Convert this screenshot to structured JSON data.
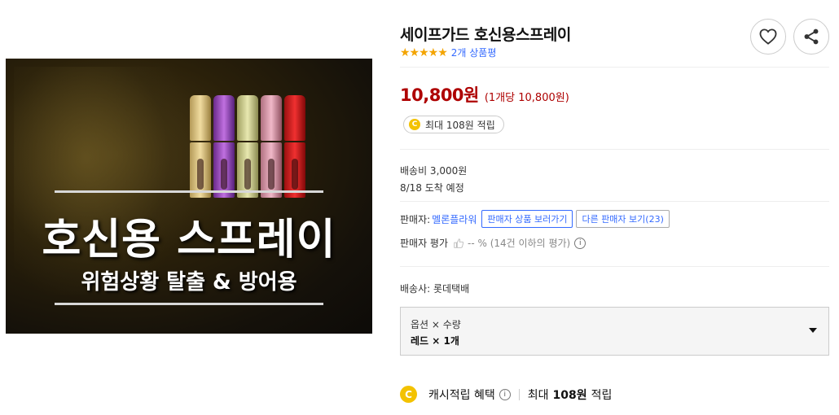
{
  "product": {
    "title": "세이프가드 호신용스프레이",
    "stars": "★★★★★",
    "review_count": "2개 상품평",
    "rating": 5,
    "price": "10,800원",
    "unit_price": "(1개당 10,800원)",
    "reward_coin": "C",
    "reward_text": "최대 108원 적립"
  },
  "image": {
    "title": "호신용 스프레이",
    "subtitle": "위험상황 탈출 & 방어용"
  },
  "shipping": {
    "fee": "배송비 3,000원",
    "arrival": "8/18 도착 예정"
  },
  "seller": {
    "label": "판매자:",
    "name": "멜론플라워",
    "view_products_button": "판매자 상품 보러가기",
    "other_sellers_button": "다른 판매자 보기(23)",
    "rating_label": "판매자 평가",
    "rating_text": "-- % (14건 이하의 평가)",
    "info_glyph": "i"
  },
  "delivery": {
    "company": "배송사: 롯데택배"
  },
  "option": {
    "header": "옵션 × 수량",
    "value": "레드 × 1개"
  },
  "cash": {
    "coin": "C",
    "label": "캐시적립 혜택",
    "info_glyph": "i",
    "prefix": "최대",
    "amount": "108원",
    "suffix": "적립"
  },
  "colors": {
    "price_red": "#ae0000",
    "link_blue": "#346aff",
    "star_orange": "#f3a400",
    "coin_yellow": "#f3c200"
  },
  "icons": {
    "wish": "heart-icon",
    "share": "share-icon",
    "thumb": "thumbs-up-icon",
    "dropdown": "caret-down-icon"
  }
}
